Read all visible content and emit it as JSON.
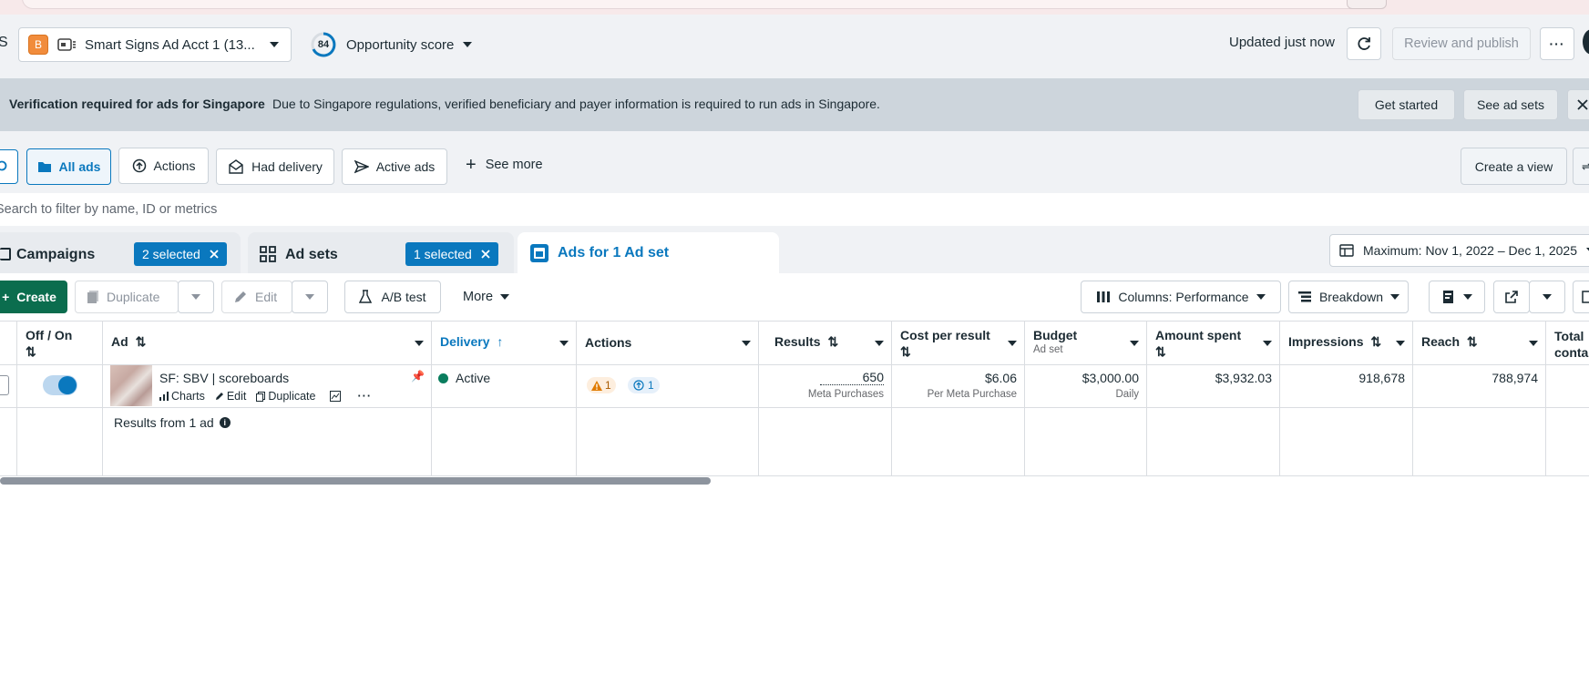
{
  "account": {
    "badge": "B",
    "name": "Smart Signs Ad Acct 1 (13...",
    "left_fragment": "S"
  },
  "opportunity": {
    "score": "84",
    "label": "Opportunity score"
  },
  "header": {
    "updated": "Updated just now",
    "review_publish": "Review and publish"
  },
  "banner": {
    "title": "Verification required for ads for Singapore",
    "message": "Due to Singapore regulations, verified beneficiary and payer information is required to run ads in Singapore.",
    "get_started": "Get started",
    "see_ad_sets": "See ad sets"
  },
  "filters": {
    "items": [
      "All ads",
      "Actions",
      "Had delivery",
      "Active ads"
    ],
    "see_more": "See more",
    "create_view": "Create a view"
  },
  "search": {
    "placeholder": "Search to filter by name, ID or metrics"
  },
  "level_tabs": {
    "campaigns": "Campaigns",
    "campaigns_selected": "2 selected",
    "ad_sets": "Ad sets",
    "ad_sets_selected": "1 selected",
    "ads": "Ads for 1 Ad set"
  },
  "date_range": "Maximum: Nov 1, 2022 – Dec 1, 2025",
  "toolbar": {
    "create": "Create",
    "duplicate": "Duplicate",
    "edit": "Edit",
    "ab_test": "A/B test",
    "more": "More",
    "columns": "Columns: Performance",
    "breakdown": "Breakdown"
  },
  "table": {
    "headers": {
      "off_on": "Off / On",
      "ad": "Ad",
      "delivery": "Delivery",
      "actions": "Actions",
      "results": "Results",
      "cost_per_result": "Cost per result",
      "budget": "Budget",
      "budget_sub": "Ad set",
      "amount_spent": "Amount spent",
      "impressions": "Impressions",
      "reach": "Reach",
      "total_contacts": "Total conta"
    },
    "row": {
      "toggle_on": true,
      "ad_name": "SF: SBV | scoreboards",
      "links": [
        "Charts",
        "Edit",
        "Duplicate"
      ],
      "delivery": "Active",
      "actions_warning": "1",
      "actions_up": "1",
      "results": "650",
      "results_sub": "Meta Purchases",
      "cost_per_result": "$6.06",
      "cost_sub": "Per Meta Purchase",
      "budget": "$3,000.00",
      "budget_sub": "Daily",
      "amount_spent": "$3,932.03",
      "impressions": "918,678",
      "reach": "788,974"
    },
    "summary": "Results from 1 ad"
  },
  "colors": {
    "accent": "#0a78be",
    "create_green": "#0b6d4e",
    "active_dot": "#0a7d5e",
    "banner_bg": "#cdd5dc",
    "warning": "#e07b00"
  }
}
